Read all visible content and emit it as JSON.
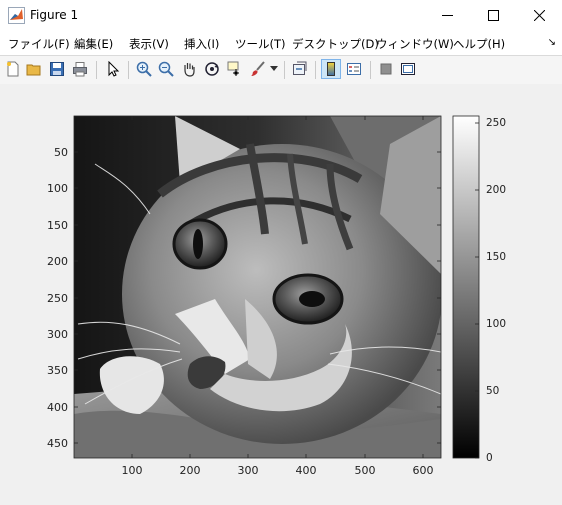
{
  "window": {
    "title": "Figure 1",
    "minimize_label": "minimize",
    "maximize_label": "maximize",
    "close_label": "close"
  },
  "menu": {
    "items": [
      "ファイル(F)",
      "編集(E)",
      "表示(V)",
      "挿入(I)",
      "ツール(T)",
      "デスクトップ(D)",
      "ウィンドウ(W)",
      "ヘルプ(H)"
    ],
    "overflow": "↘"
  },
  "toolbar": {
    "icons": [
      "new-figure-icon",
      "open-file-icon",
      "save-icon",
      "print-icon",
      "edit-plot-arrow-icon",
      "zoom-in-icon",
      "zoom-out-icon",
      "pan-hand-icon",
      "rotate-3d-icon",
      "data-cursor-icon",
      "brush-icon",
      "link-plot-icon",
      "colorbar-icon",
      "legend-icon",
      "hide-plot-tools-icon",
      "show-plot-tools-icon"
    ]
  },
  "plot": {
    "yticks": [
      "50",
      "100",
      "150",
      "200",
      "250",
      "300",
      "350",
      "400",
      "450"
    ],
    "xticks": [
      "100",
      "200",
      "300",
      "400",
      "500",
      "600"
    ],
    "colorbar_ticks": [
      "250",
      "200",
      "150",
      "100",
      "50",
      "0"
    ]
  },
  "chart_data": {
    "type": "heatmap",
    "colormap": "gray",
    "image_size": [
      470,
      630
    ],
    "xlim": [
      0.5,
      630.5
    ],
    "ylim": [
      0.5,
      470.5
    ],
    "ydir": "reverse",
    "xticks": [
      100,
      200,
      300,
      400,
      500,
      600
    ],
    "yticks": [
      50,
      100,
      150,
      200,
      250,
      300,
      350,
      400,
      450
    ],
    "clim": [
      0,
      255
    ],
    "colorbar_ticks": [
      0,
      50,
      100,
      150,
      200,
      250
    ],
    "grid": false
  },
  "colors": {
    "titlebar": "#ffffff",
    "toolbar_bg": "#f5f5f5",
    "figure_bg": "#f0f0f0",
    "toggle_on": "#cde6f7"
  }
}
